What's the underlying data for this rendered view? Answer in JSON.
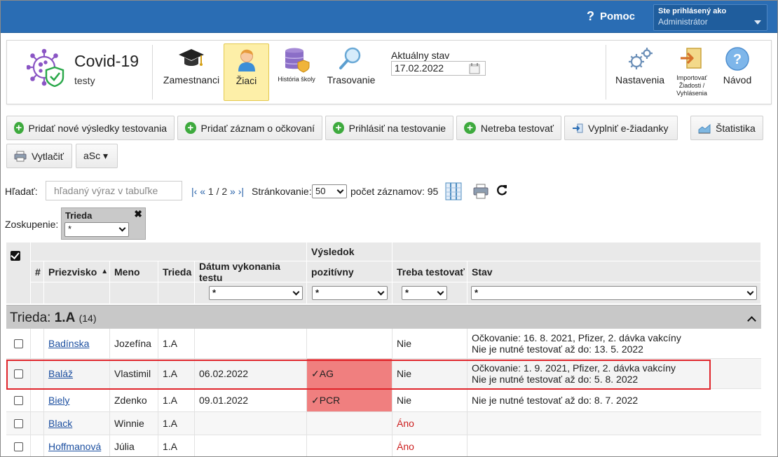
{
  "topbar": {
    "help_icon": "?",
    "help_label": "Pomoc",
    "user_line1": "Ste prihlásený ako",
    "user_line2": "Administrátor"
  },
  "header": {
    "app_title": "Covid-19",
    "app_subtitle": "testy",
    "tools_left": [
      {
        "label": "Zamestnanci",
        "icon": "graduation-cap-icon"
      },
      {
        "label": "Žiaci",
        "icon": "student-icon"
      },
      {
        "label": "História školy",
        "icon": "database-shield-icon"
      },
      {
        "label": "Trasovanie",
        "icon": "magnifier-icon"
      }
    ],
    "state_label": "Aktuálny stav",
    "state_date": "17.02.2022",
    "tools_right": [
      {
        "label": "Nastavenia",
        "icon": "gears-icon"
      },
      {
        "label": "Importovať Žiadosti / Vyhlásenia",
        "icon": "import-icon"
      },
      {
        "label": "Návod",
        "icon": "help-circle-icon"
      }
    ]
  },
  "actions": {
    "add_results": "Pridať nové výsledky testovania",
    "add_vaccination": "Pridať záznam o očkovaní",
    "register_testing": "Prihlásiť na testovanie",
    "no_testing": "Netreba testovať",
    "fill_forms": "Vyplniť e-žiadanky",
    "statistics": "Štatistika",
    "print": "Vytlačiť",
    "asc": "aSc ▾"
  },
  "search": {
    "label": "Hľadať:",
    "placeholder": "hľadaný výraz v tabuľke",
    "pager_first": "|‹",
    "pager_prev": "«",
    "pager_text": "1 / 2",
    "pager_next": "»",
    "pager_last": "›|",
    "paging_label": "Stránkovanie:",
    "page_size": "50",
    "count_label": "počet záznamov: 95"
  },
  "grouping": {
    "label": "Zoskupenie:",
    "title": "Trieda",
    "value": "*"
  },
  "table": {
    "group_header": "Výsledok",
    "columns": {
      "num": "#",
      "surname": "Priezvisko",
      "surname_sort": "▲",
      "name": "Meno",
      "class": "Trieda",
      "date": "Dátum vykonania testu",
      "positive": "pozitívny",
      "need": "Treba testovať",
      "state": "Stav"
    },
    "filters": {
      "date": "*",
      "positive": "*",
      "need": "*",
      "state": "*"
    },
    "group_row": {
      "prefix": "Trieda: ",
      "name": "1.A",
      "count": "(14)"
    },
    "rows": [
      {
        "surname": "Badínska",
        "name": "Jozefína",
        "class": "1.A",
        "date": "",
        "positive": "",
        "need": "Nie",
        "state1": "Očkovanie: 16. 8. 2021, Pfizer, 2. dávka vakcíny",
        "state2": "Nie je nutné testovať až do: 13. 5. 2022"
      },
      {
        "surname": "Baláž",
        "name": "Vlastimil",
        "class": "1.A",
        "date": "06.02.2022",
        "positive": "✓AG",
        "need": "Nie",
        "state1": "Očkovanie: 1. 9. 2021, Pfizer, 2. dávka vakcíny",
        "state2": "Nie je nutné testovať až do: 5. 8. 2022"
      },
      {
        "surname": "Biely",
        "name": "Zdenko",
        "class": "1.A",
        "date": "09.01.2022",
        "positive": "✓PCR",
        "need": "Nie",
        "state1": "Nie je nutné testovať až do: 8. 7. 2022",
        "state2": ""
      },
      {
        "surname": "Black",
        "name": "Winnie",
        "class": "1.A",
        "date": "",
        "positive": "",
        "need": "Áno",
        "state1": "",
        "state2": ""
      },
      {
        "surname": "Hoffmanová",
        "name": "Júlia",
        "class": "1.A",
        "date": "",
        "positive": "",
        "need": "Áno",
        "state1": "",
        "state2": ""
      }
    ]
  },
  "colors": {
    "topbar": "#2a6db4",
    "active_tool": "#fdefa8",
    "positive": "#f07f7f",
    "highlight": "#e0252b",
    "link": "#1c4fa0"
  }
}
